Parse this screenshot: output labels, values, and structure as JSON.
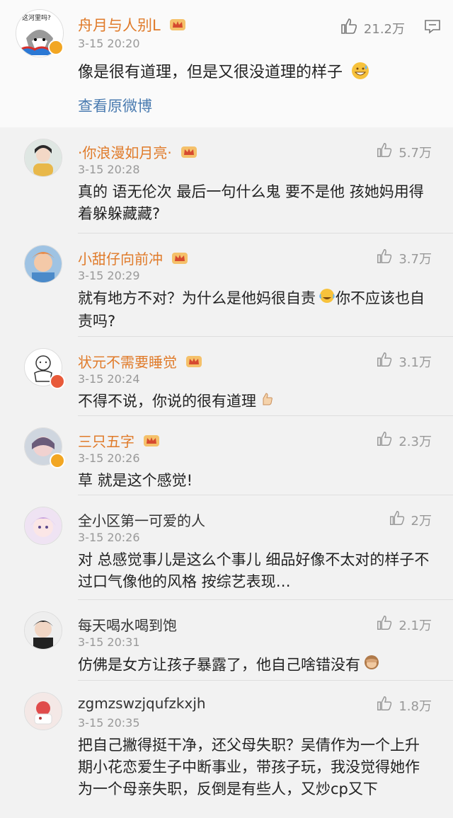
{
  "main_post": {
    "username": "舟月与人别L",
    "avatar_text": "这河里吗?",
    "time": "3-15 20:20",
    "text": "像是很有道理，但是又很没道理的样子",
    "likes": "21.2万",
    "view_original": "查看原微博"
  },
  "comments": [
    {
      "username": "·你浪漫如月亮·",
      "time": "3-15 20:28",
      "text": "真的 语无伦次 最后一句什么鬼 要不是他 孩她妈用得着躲躲藏藏?",
      "likes": "5.7万"
    },
    {
      "username": "小甜仔向前冲",
      "time": "3-15 20:29",
      "text": "就有地方不对？为什么是他妈很自责",
      "text_after": "你不应该也自责吗?",
      "likes": "3.7万"
    },
    {
      "username": "状元不需要睡觉",
      "time": "3-15 20:24",
      "text": "不得不说，你说的很有道理",
      "likes": "3.1万"
    },
    {
      "username": "三只五字",
      "time": "3-15 20:26",
      "text": "草 就是这个感觉!",
      "likes": "2.3万"
    },
    {
      "username": "全小区第一可爱的人",
      "time": "3-15 20:26",
      "text": "对 总感觉事儿是这么个事儿 细品好像不太对的样子不过口气像他的风格 按综艺表现…",
      "likes": "2万"
    },
    {
      "username": "每天喝水喝到饱",
      "time": "3-15 20:31",
      "text": "仿佛是女方让孩子暴露了，他自己啥错没有",
      "likes": "2.1万"
    },
    {
      "username": "zgmzswzjqufzkxjh",
      "time": "3-15 20:35",
      "text": "把自己撇得挺干净，还父母失职？吴倩作为一个上升期小花恋爱生子中断事业，带孩子玩，我没觉得她作为一个母亲失职，反倒是有些人，又炒cp又下",
      "likes": "1.8万"
    }
  ]
}
